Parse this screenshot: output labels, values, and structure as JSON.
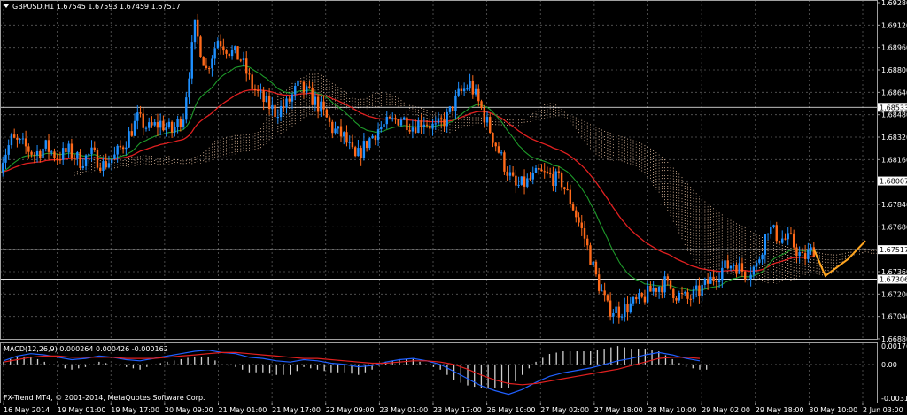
{
  "header": {
    "symbol_info": "GBPUSD,H1  1.67545 1.67593 1.67459 1.67517"
  },
  "copyright": "FX-Trend MT4, © 2001-2014, MetaQuotes Software Corp.",
  "colors": {
    "background": "#000000",
    "grid": "#5a5a5a",
    "bull_candle": "#1e90ff",
    "bear_candle": "#ff6a1a",
    "ma_red": "#e02020",
    "ma_green": "#1e9a2a",
    "cloud": "#f0c8a8",
    "forecast": "#ffa520",
    "hline": "#ffffff",
    "macd_line": "#2060ff",
    "signal_line": "#e02020",
    "histogram": "#d0d0d0"
  },
  "chart_data": [
    {
      "type": "candlestick",
      "title": "GBPUSD,H1",
      "ylim": [
        1.6688,
        1.6928
      ],
      "y_ticks": [
        "1.69280",
        "1.69120",
        "1.68960",
        "1.68800",
        "1.68640",
        "1.68480",
        "1.68320",
        "1.68160",
        "1.68000",
        "1.67840",
        "1.67680",
        "1.67520",
        "1.67360",
        "1.67200",
        "1.67040",
        "1.66880"
      ],
      "x_ticks": [
        "16 May 2014",
        "19 May 01:00",
        "19 May 17:00",
        "20 May 09:00",
        "21 May 01:00",
        "21 May 17:00",
        "22 May 09:00",
        "23 May 01:00",
        "23 May 17:00",
        "26 May 10:00",
        "27 May 02:00",
        "27 May 18:00",
        "28 May 10:00",
        "29 May 02:00",
        "29 May 18:00",
        "30 May 10:00",
        "2 Jun 03:00"
      ],
      "last_price": {
        "open": 1.67545,
        "high": 1.67593,
        "low": 1.67459,
        "close": 1.67517
      },
      "price_levels": [
        {
          "label": "1.68533",
          "value": 1.68533
        },
        {
          "label": "1.68007",
          "value": 1.68007
        },
        {
          "label": "1.67517",
          "value": 1.67517
        },
        {
          "label": "1.67306",
          "value": 1.67306
        }
      ],
      "close_path": [
        [
          0,
          1.6813
        ],
        [
          4,
          1.683
        ],
        [
          8,
          1.6826
        ],
        [
          12,
          1.682
        ],
        [
          16,
          1.6825
        ],
        [
          20,
          1.6818
        ],
        [
          24,
          1.6822
        ],
        [
          28,
          1.6815
        ],
        [
          32,
          1.682
        ],
        [
          36,
          1.6812
        ],
        [
          40,
          1.6818
        ],
        [
          44,
          1.683
        ],
        [
          48,
          1.6845
        ],
        [
          52,
          1.6838
        ],
        [
          56,
          1.6842
        ],
        [
          60,
          1.6836
        ],
        [
          64,
          1.6848
        ],
        [
          68,
          1.691
        ],
        [
          72,
          1.688
        ],
        [
          76,
          1.6902
        ],
        [
          80,
          1.6894
        ],
        [
          84,
          1.6888
        ],
        [
          88,
          1.6868
        ],
        [
          92,
          1.6858
        ],
        [
          96,
          1.685
        ],
        [
          100,
          1.6855
        ],
        [
          104,
          1.6868
        ],
        [
          108,
          1.6862
        ],
        [
          112,
          1.6852
        ],
        [
          116,
          1.6838
        ],
        [
          120,
          1.6832
        ],
        [
          124,
          1.6816
        ],
        [
          128,
          1.6828
        ],
        [
          132,
          1.6838
        ],
        [
          136,
          1.6842
        ],
        [
          140,
          1.6846
        ],
        [
          144,
          1.684
        ],
        [
          148,
          1.6844
        ],
        [
          152,
          1.6838
        ],
        [
          156,
          1.6846
        ],
        [
          160,
          1.6862
        ],
        [
          164,
          1.687
        ],
        [
          168,
          1.6852
        ],
        [
          172,
          1.6832
        ],
        [
          176,
          1.6812
        ],
        [
          180,
          1.6796
        ],
        [
          184,
          1.68
        ],
        [
          188,
          1.6806
        ],
        [
          192,
          1.6804
        ],
        [
          196,
          1.68
        ],
        [
          200,
          1.6782
        ],
        [
          204,
          1.676
        ],
        [
          208,
          1.6732
        ],
        [
          212,
          1.671
        ],
        [
          216,
          1.6708
        ],
        [
          220,
          1.6712
        ],
        [
          224,
          1.6716
        ],
        [
          228,
          1.6724
        ],
        [
          232,
          1.6728
        ],
        [
          236,
          1.672
        ],
        [
          240,
          1.6716
        ],
        [
          244,
          1.6722
        ],
        [
          248,
          1.673
        ],
        [
          252,
          1.6738
        ],
        [
          256,
          1.6742
        ],
        [
          260,
          1.6735
        ],
        [
          264,
          1.674
        ],
        [
          268,
          1.6768
        ],
        [
          272,
          1.676
        ],
        [
          276,
          1.6758
        ],
        [
          280,
          1.6745
        ],
        [
          284,
          1.6752
        ]
      ],
      "forecast_path": [
        [
          284,
          1.6752
        ],
        [
          288,
          1.6733
        ],
        [
          296,
          1.6745
        ],
        [
          302,
          1.6758
        ]
      ],
      "x_max": 306
    },
    {
      "type": "line",
      "title": "MACD(12,26,9) 0.000264 0.000426 -0.000162",
      "ylim": [
        -0.003199,
        0.001769
      ],
      "y_ticks": [
        "0.001769",
        "0.00",
        "-0.003199"
      ],
      "series": [
        {
          "name": "MACD",
          "values": [
            0.0003,
            0.0007,
            0.0009,
            0.0008,
            0.0006,
            0.0004,
            0.0005,
            0.0007,
            0.0006,
            0.0004,
            0.0003,
            0.0005,
            0.0007,
            0.0009,
            0.0011,
            0.0012,
            0.001,
            0.0009,
            0.0006,
            0.0005,
            0.0003,
            0.0002,
            0.0004,
            0.0003,
            0.0001,
            0.0,
            -0.0002,
            -0.0001,
            0.0002,
            0.0004,
            0.0005,
            0.0003,
            0.0,
            -0.0006,
            -0.0012,
            -0.0018,
            -0.0022,
            -0.0025,
            -0.0021,
            -0.0015,
            -0.001,
            -0.0007,
            -0.0005,
            -0.0003,
            0.0,
            0.0003,
            0.0005,
            0.0008,
            0.001,
            0.0008,
            0.0005,
            0.0003
          ]
        },
        {
          "name": "Signal",
          "values": [
            0.0002,
            0.0004,
            0.0006,
            0.0007,
            0.0007,
            0.0006,
            0.0006,
            0.0006,
            0.0006,
            0.0005,
            0.0005,
            0.0005,
            0.0006,
            0.0007,
            0.0008,
            0.0009,
            0.001,
            0.001,
            0.0009,
            0.0008,
            0.0007,
            0.0006,
            0.0005,
            0.0005,
            0.0004,
            0.0003,
            0.0002,
            0.0001,
            0.0001,
            0.0002,
            0.0003,
            0.0003,
            0.0002,
            0.0,
            -0.0004,
            -0.0009,
            -0.0013,
            -0.0016,
            -0.0017,
            -0.0016,
            -0.0014,
            -0.0012,
            -0.001,
            -0.0008,
            -0.0006,
            -0.0004,
            -0.0001,
            0.0002,
            0.0005,
            0.0006,
            0.0006,
            0.0005
          ]
        }
      ]
    }
  ]
}
